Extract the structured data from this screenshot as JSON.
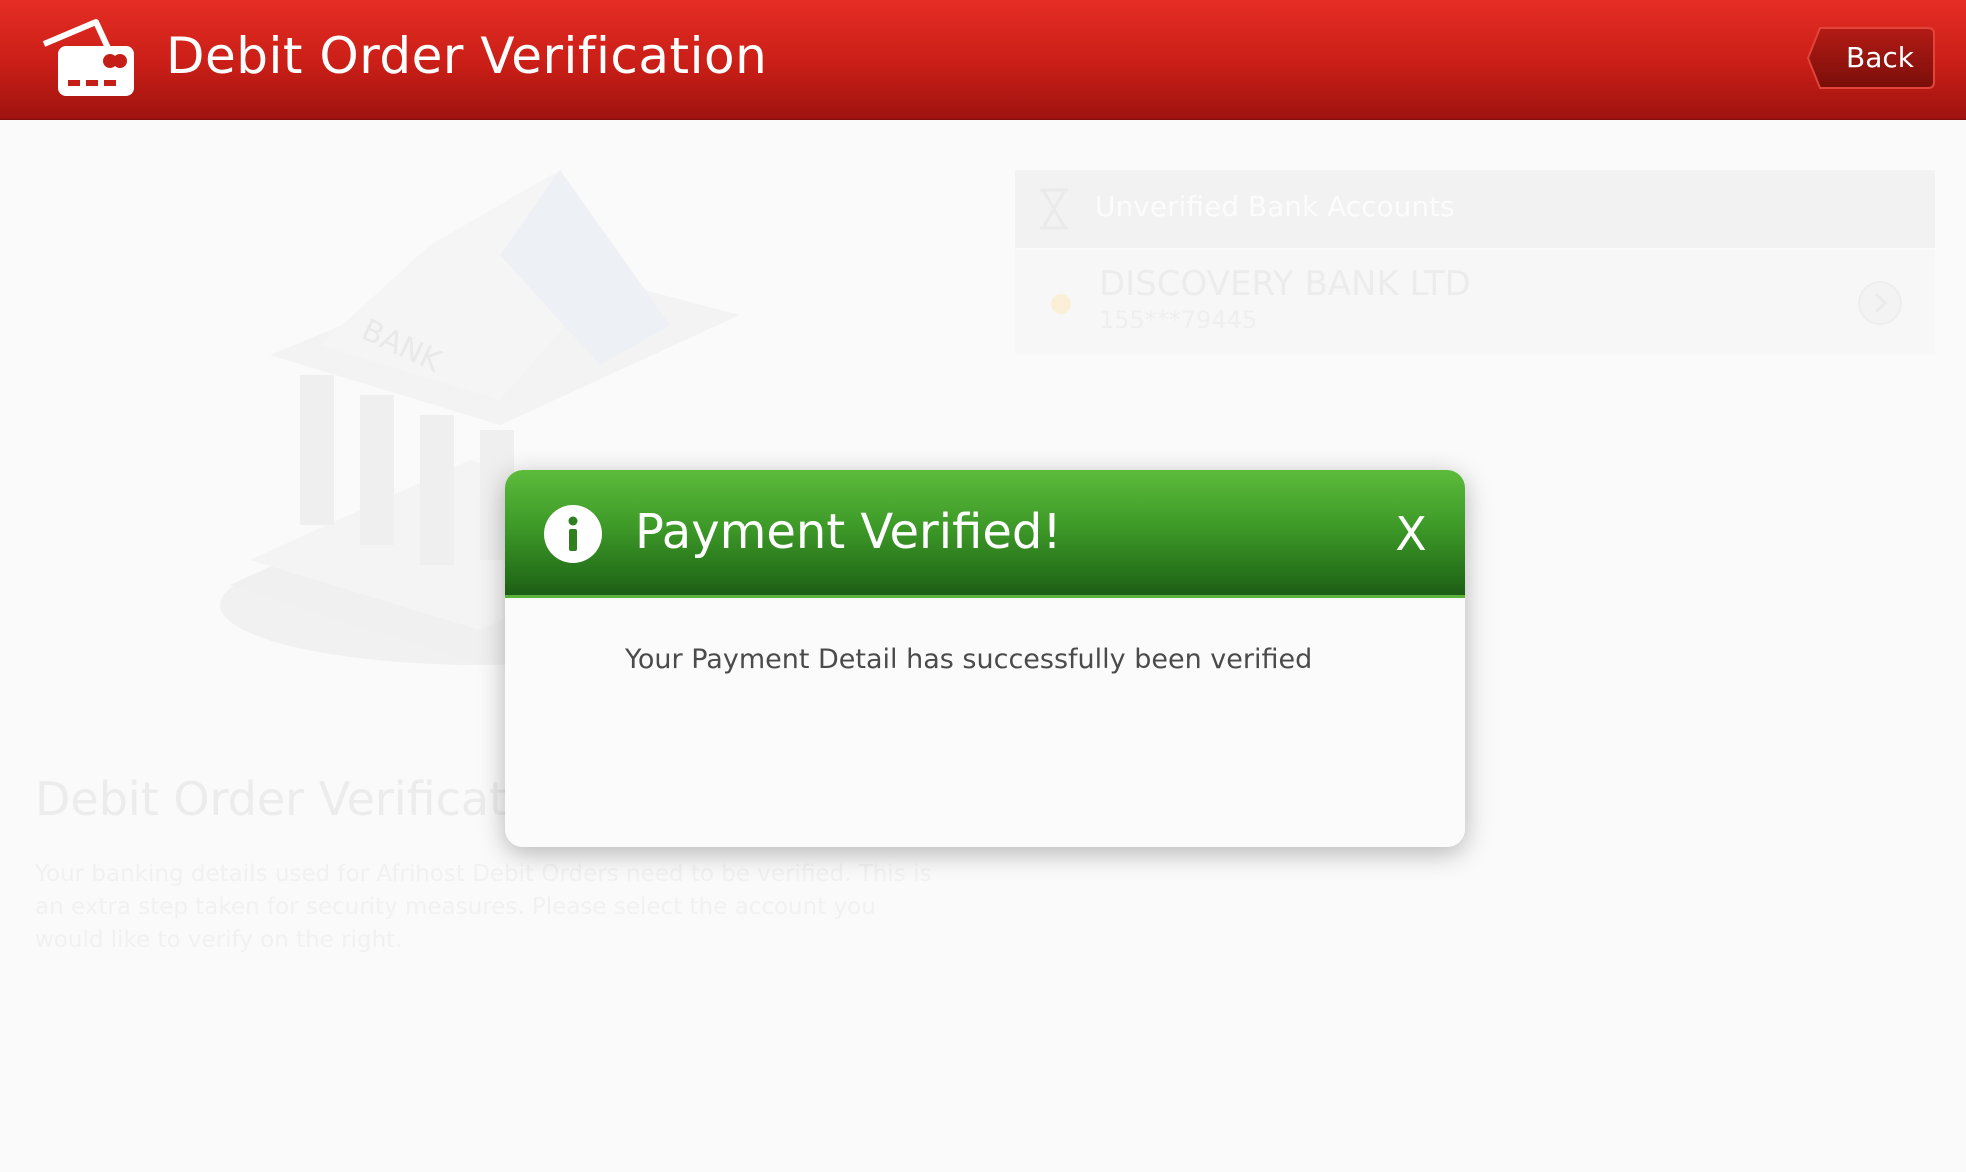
{
  "header": {
    "title": "Debit Order Verification",
    "back_label": "Back",
    "icon": "credit-cards-icon",
    "accent_color": "#d42a21"
  },
  "background": {
    "illustration_label": "BANK",
    "heading": "Debit Order Verification",
    "description": "Your banking details used for Afrihost Debit Orders need to be verified. This is an extra step taken for security measures. Please select the account you would like to verify on the right."
  },
  "accounts": {
    "header_label": "Unverified Bank Accounts",
    "items": [
      {
        "bank_name": "DISCOVERY BANK LTD",
        "account_number": "155***79445"
      }
    ]
  },
  "modal": {
    "title": "Payment Verified!",
    "close_label": "X",
    "message": "Your Payment Detail has successfully been verified",
    "header_color": "#3e9a28"
  }
}
